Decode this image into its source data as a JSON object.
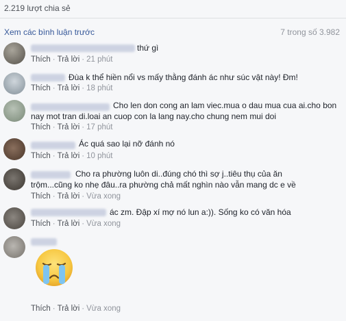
{
  "header": {
    "share_count": "2.219 lượt chia sẻ",
    "view_previous": "Xem các bình luận trước",
    "count_label": "7 trong số 3.982"
  },
  "actions": {
    "like": "Thích",
    "reply": "Trả lời",
    "separator": "·"
  },
  "comments": [
    {
      "text": "thứ gì",
      "time": "21 phút"
    },
    {
      "text": "Đùa k thể hiền nổi vs mấy thằng đánh ác như súc vật này! Đm!",
      "time": "18 phút"
    },
    {
      "text": "Cho len don cong an lam viec.mua o dau mua cua ai.cho bon nay mot tran di.loai an cuop con la lang nay.cho chung nem mui doi",
      "time": "17 phút"
    },
    {
      "text": "Ác quá sao lại nỡ đánh nó",
      "time": "10 phút"
    },
    {
      "text": "Cho ra phường luôn di..đúng chó thì sợ j..tiêu thụ của ăn trộm...cũng ko nhẹ đâu..ra phường chả mất nghìn nào vẫn mang dc e về",
      "time": "Vừa xong"
    },
    {
      "text": "ác zm. Đập xí mợ nó lun a:)). Sống ko có văn hóa",
      "time": "Vừa xong"
    },
    {
      "text": "",
      "time": "Vừa xong",
      "sticker": "crying-face-sticker"
    }
  ]
}
